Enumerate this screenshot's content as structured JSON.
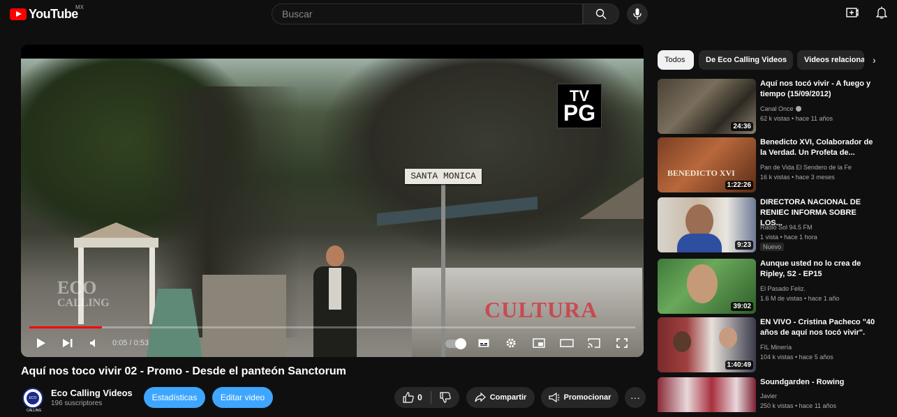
{
  "topbar": {
    "logo_text": "YouTube",
    "country_code": "MX",
    "search_placeholder": "Buscar"
  },
  "player": {
    "time": "0:05 / 0:53",
    "progress_fraction": 0.12,
    "sign_text": "SANTA MONICA",
    "watermark_left": "ECO",
    "watermark_left_sub": "CALLING",
    "watermark_right": "CULTURA",
    "rating_tv": "TV",
    "rating_pg": "PG"
  },
  "video": {
    "title": "Aquí nos toco vivir 02 - Promo - Desde el panteón Sanctorum",
    "channel_name": "Eco Calling Videos",
    "subscribers": "196 suscriptores",
    "avatar_text": "ECO CALLING",
    "stats_label": "Estadísticas",
    "edit_label": "Editar video",
    "likes": "0",
    "share_label": "Compartir",
    "promote_label": "Promocionar",
    "more_label": "···"
  },
  "chips": [
    {
      "label": "Todos"
    },
    {
      "label": "De Eco Calling Videos"
    },
    {
      "label": "Videos relacionados"
    }
  ],
  "recommendations": [
    {
      "title": "Aquí nos tocó vivir - A fuego y tiempo (15/09/2012)",
      "channel": "Canal Once",
      "meta": "62 k vistas  • hace 11 años",
      "duration": "24:36",
      "verified": true
    },
    {
      "title": "Benedicto XVI, Colaborador de la Verdad. Un Profeta de...",
      "channel": "Pan de Vida El Sendero de la Fe",
      "meta": "16 k vistas  • hace 3 meses",
      "duration": "1:22:26",
      "thumb_text": "BENEDICTO XVI"
    },
    {
      "title": "DIRECTORA NACIONAL DE RENIEC INFORMA SOBRE LOS...",
      "channel": "Radio Sol 94.5 FM",
      "meta": "1 vista  • hace 1 hora",
      "duration": "9:23",
      "badge": "Nuevo"
    },
    {
      "title": "Aunque usted no lo crea de Ripley, S2 - EP15",
      "channel": "El Pasado Feliz.",
      "meta": "1.6 M de vistas  • hace 1 año",
      "duration": "39:02"
    },
    {
      "title": "EN VIVO - Cristina Pacheco \"40 años de aquí nos tocó vivir\".",
      "channel": "FIL Minería",
      "meta": "104 k vistas  • hace 5 años",
      "duration": "1:40:49"
    },
    {
      "title": "Soundgarden - Rowing",
      "channel": "Javier",
      "meta": "250 k vistas  • hace 11 años"
    }
  ],
  "colors": {
    "accent": "#ff0000",
    "blue": "#3ea6ff",
    "background": "#0f0f0f"
  }
}
